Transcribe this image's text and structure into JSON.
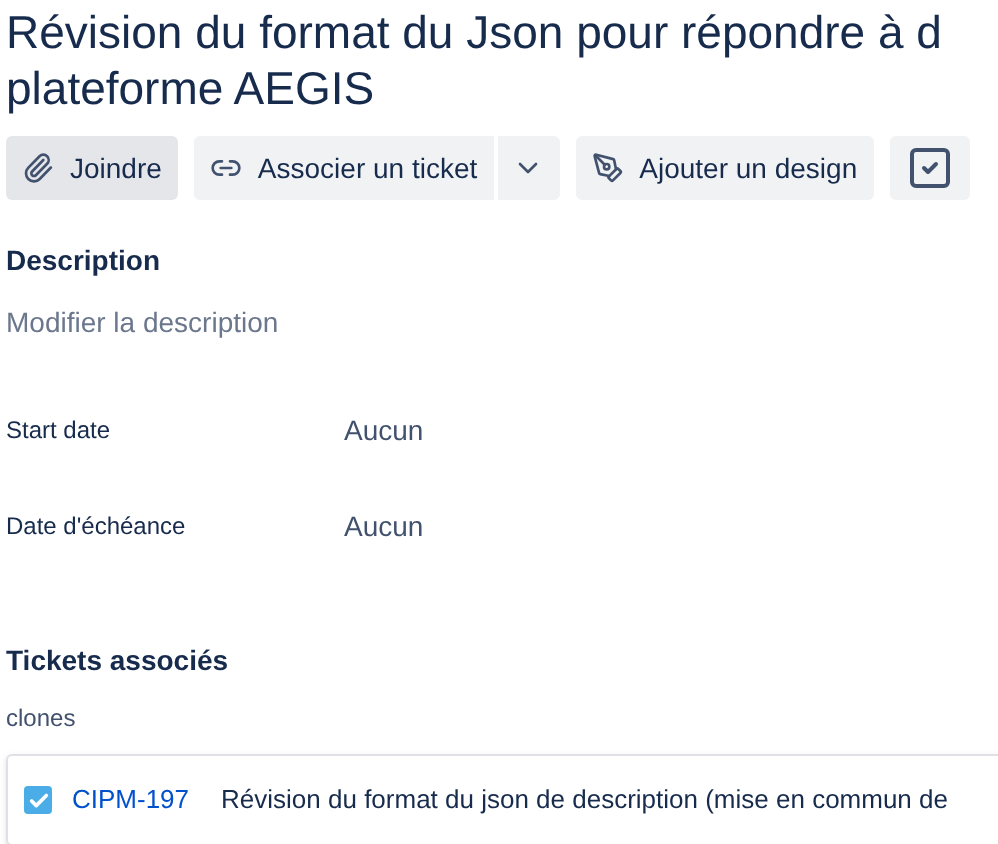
{
  "title_lines": [
    "Révision du format du Json pour répondre à d",
    "plateforme AEGIS"
  ],
  "actions": [
    {
      "label": "Joindre",
      "kind": "attach",
      "selected": true
    },
    {
      "label": "Associer un ticket",
      "kind": "link",
      "selected": false
    },
    {
      "label": "Ajouter un design",
      "kind": "design",
      "selected": false
    },
    {
      "kind": "checklist",
      "selected": false
    }
  ],
  "description": {
    "label": "Description",
    "placeholder": "Modifier la description"
  },
  "fields": [
    {
      "label": "Start date",
      "value": "Aucun"
    },
    {
      "label": "Date d'échéance",
      "value": "Aucun"
    }
  ],
  "linked": {
    "heading": "Tickets associés",
    "relation": "clones",
    "tickets": [
      {
        "key": "CIPM-197",
        "summary": "Révision du format du json de description (mise en commun de"
      }
    ]
  }
}
